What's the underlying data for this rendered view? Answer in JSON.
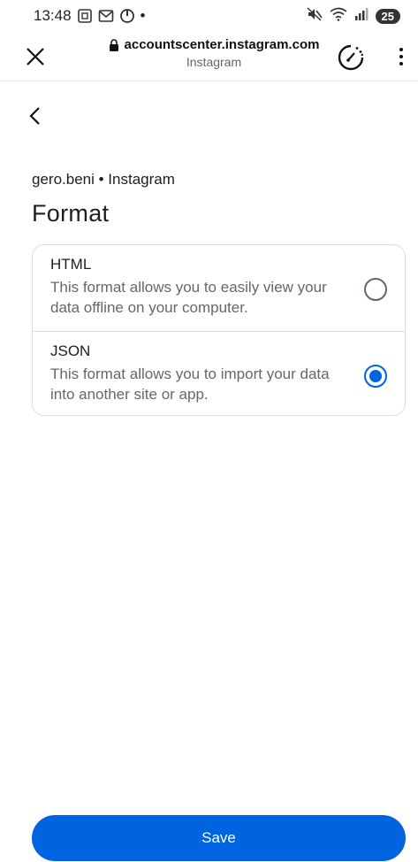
{
  "status_bar": {
    "time": "13:48",
    "dot": "•",
    "battery": "25"
  },
  "browser": {
    "url": "accountscenter.instagram.com",
    "site_name": "Instagram",
    "icons": [
      "close-icon",
      "lock-icon",
      "speed-icon",
      "more-vertical-icon"
    ]
  },
  "page": {
    "account_line": "gero.beni • Instagram",
    "title": "Format"
  },
  "options": [
    {
      "title": "HTML",
      "description": "This format allows you to easily view your data offline on your computer.",
      "selected": false
    },
    {
      "title": "JSON",
      "description": "This format allows you to import your data into another site or app.",
      "selected": true
    }
  ],
  "save_button": {
    "label": "Save"
  },
  "colors": {
    "accent": "#0064e0",
    "text": "#1c1e21",
    "secondary_text": "#65676b",
    "border": "#dadde1"
  }
}
